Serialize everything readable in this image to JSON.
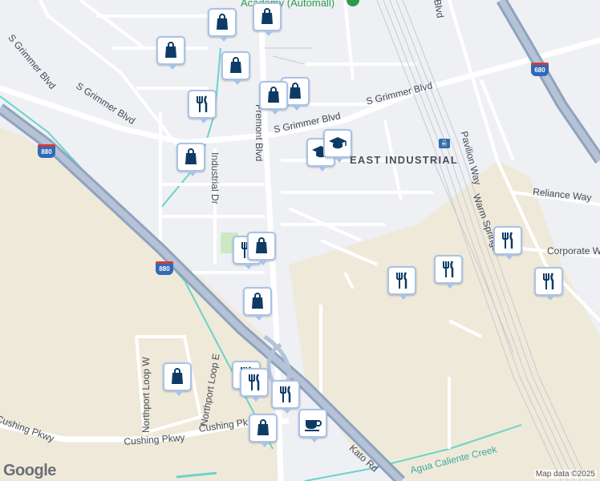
{
  "map": {
    "attribution": "Map data ©2025",
    "logo_text": "Google",
    "area_label": "EAST INDUSTRIAL",
    "poi_label": "Academy (Automall)",
    "streets": {
      "s_grimmer_upper_left": "S Grimmer Blvd",
      "s_grimmer_lower_left": "S Grimmer Blvd",
      "s_grimmer_mid": "S Grimmer Blvd",
      "s_grimmer_right": "S Grimmer Blvd",
      "fremont": "Fremont Blvd",
      "industrial": "Industrial Dr",
      "pavilion": "Pavilion Way",
      "reliance": "Reliance Way",
      "corporate": "Corporate Way",
      "warm_springs": "Warm Springs",
      "northport_w": "Northport Loop W",
      "northport_e": "Northport Loop E",
      "cushing_left": "Cushing Pkwy",
      "cushing_mid": "Cushing Pkwy",
      "cushing_right": "Cushing Pk",
      "kato": "Kato Rd",
      "creek": "Agua Caliente Creek",
      "top_right": "Blvd"
    },
    "shields": {
      "i880_a": "880",
      "i880_b": "880",
      "i680": "680"
    },
    "colors": {
      "pin_border": "#a9c3e6",
      "icon": "#0d3b66",
      "freeway": "#8fa3bf",
      "street": "#ffffff",
      "land": "#eef0f4",
      "industrial_land": "#efe9da",
      "water": "#6ad4c9",
      "park": "#cde9c3"
    },
    "markers": [
      {
        "icon": "shopping-bag-icon",
        "name": "shop-marker-1"
      },
      {
        "icon": "shopping-bag-icon",
        "name": "shop-marker-2"
      },
      {
        "icon": "shopping-bag-icon",
        "name": "shop-marker-3"
      },
      {
        "icon": "shopping-bag-icon",
        "name": "shop-marker-4"
      },
      {
        "icon": "shopping-bag-icon",
        "name": "shop-marker-5"
      },
      {
        "icon": "restaurant-icon",
        "name": "restaurant-marker-1"
      },
      {
        "icon": "shopping-bag-icon",
        "name": "shop-marker-6"
      },
      {
        "icon": "graduation-cap-icon",
        "name": "school-marker-1"
      },
      {
        "icon": "graduation-cap-icon",
        "name": "school-marker-2"
      },
      {
        "icon": "restaurant-icon",
        "name": "restaurant-marker-2"
      },
      {
        "icon": "shopping-bag-icon",
        "name": "shop-marker-7"
      },
      {
        "icon": "shopping-bag-icon",
        "name": "shop-marker-8"
      },
      {
        "icon": "restaurant-icon",
        "name": "restaurant-marker-3"
      },
      {
        "icon": "restaurant-icon",
        "name": "restaurant-marker-4"
      },
      {
        "icon": "restaurant-icon",
        "name": "restaurant-marker-5"
      },
      {
        "icon": "restaurant-icon",
        "name": "restaurant-marker-6"
      },
      {
        "icon": "shopping-bag-icon",
        "name": "shop-marker-9"
      },
      {
        "icon": "restaurant-icon",
        "name": "restaurant-marker-7"
      },
      {
        "icon": "restaurant-icon",
        "name": "restaurant-marker-8"
      },
      {
        "icon": "restaurant-icon",
        "name": "restaurant-marker-9"
      },
      {
        "icon": "shopping-bag-icon",
        "name": "shop-marker-10"
      },
      {
        "icon": "shopping-bag-icon",
        "name": "shop-marker-11"
      },
      {
        "icon": "cafe-icon",
        "name": "cafe-marker-1"
      }
    ]
  }
}
